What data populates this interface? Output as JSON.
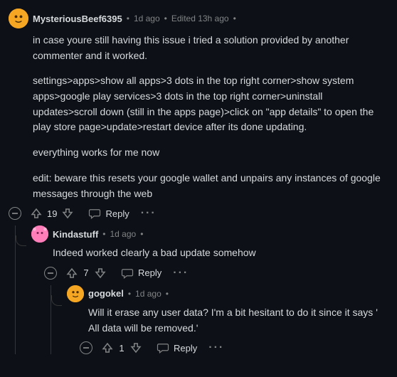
{
  "ui": {
    "reply_label": "Reply",
    "more_label": "···"
  },
  "comments": [
    {
      "username": "MysteriousBeef6395",
      "timestamp": "1d ago",
      "edited": "Edited 13h ago",
      "avatar_bg": "#f5a623",
      "paragraphs": [
        "in case youre still having this issue i tried a solution provided by another commenter and it worked.",
        "settings>apps>show all apps>3 dots in the top right corner>show system apps>google play services>3 dots in the top right corner>uninstall updates>scroll down (still in the apps page)>click on \"app details\" to open the play store page>update>restart device after its done updating.",
        "everything works for me now",
        "edit: beware this resets your google wallet and unpairs any instances of google messages through the web"
      ],
      "score": "19",
      "replies": [
        {
          "username": "Kindastuff",
          "timestamp": "1d ago",
          "avatar_bg": "#ff7eb9",
          "paragraphs": [
            "Indeed worked clearly a bad update somehow"
          ],
          "score": "7",
          "replies": [
            {
              "username": "gogokel",
              "timestamp": "1d ago",
              "avatar_bg": "#f5a623",
              "paragraphs": [
                "Will it erase any user data? I'm a bit hesitant to do it since it says ' All data will be removed.'"
              ],
              "score": "1"
            }
          ]
        }
      ]
    }
  ]
}
